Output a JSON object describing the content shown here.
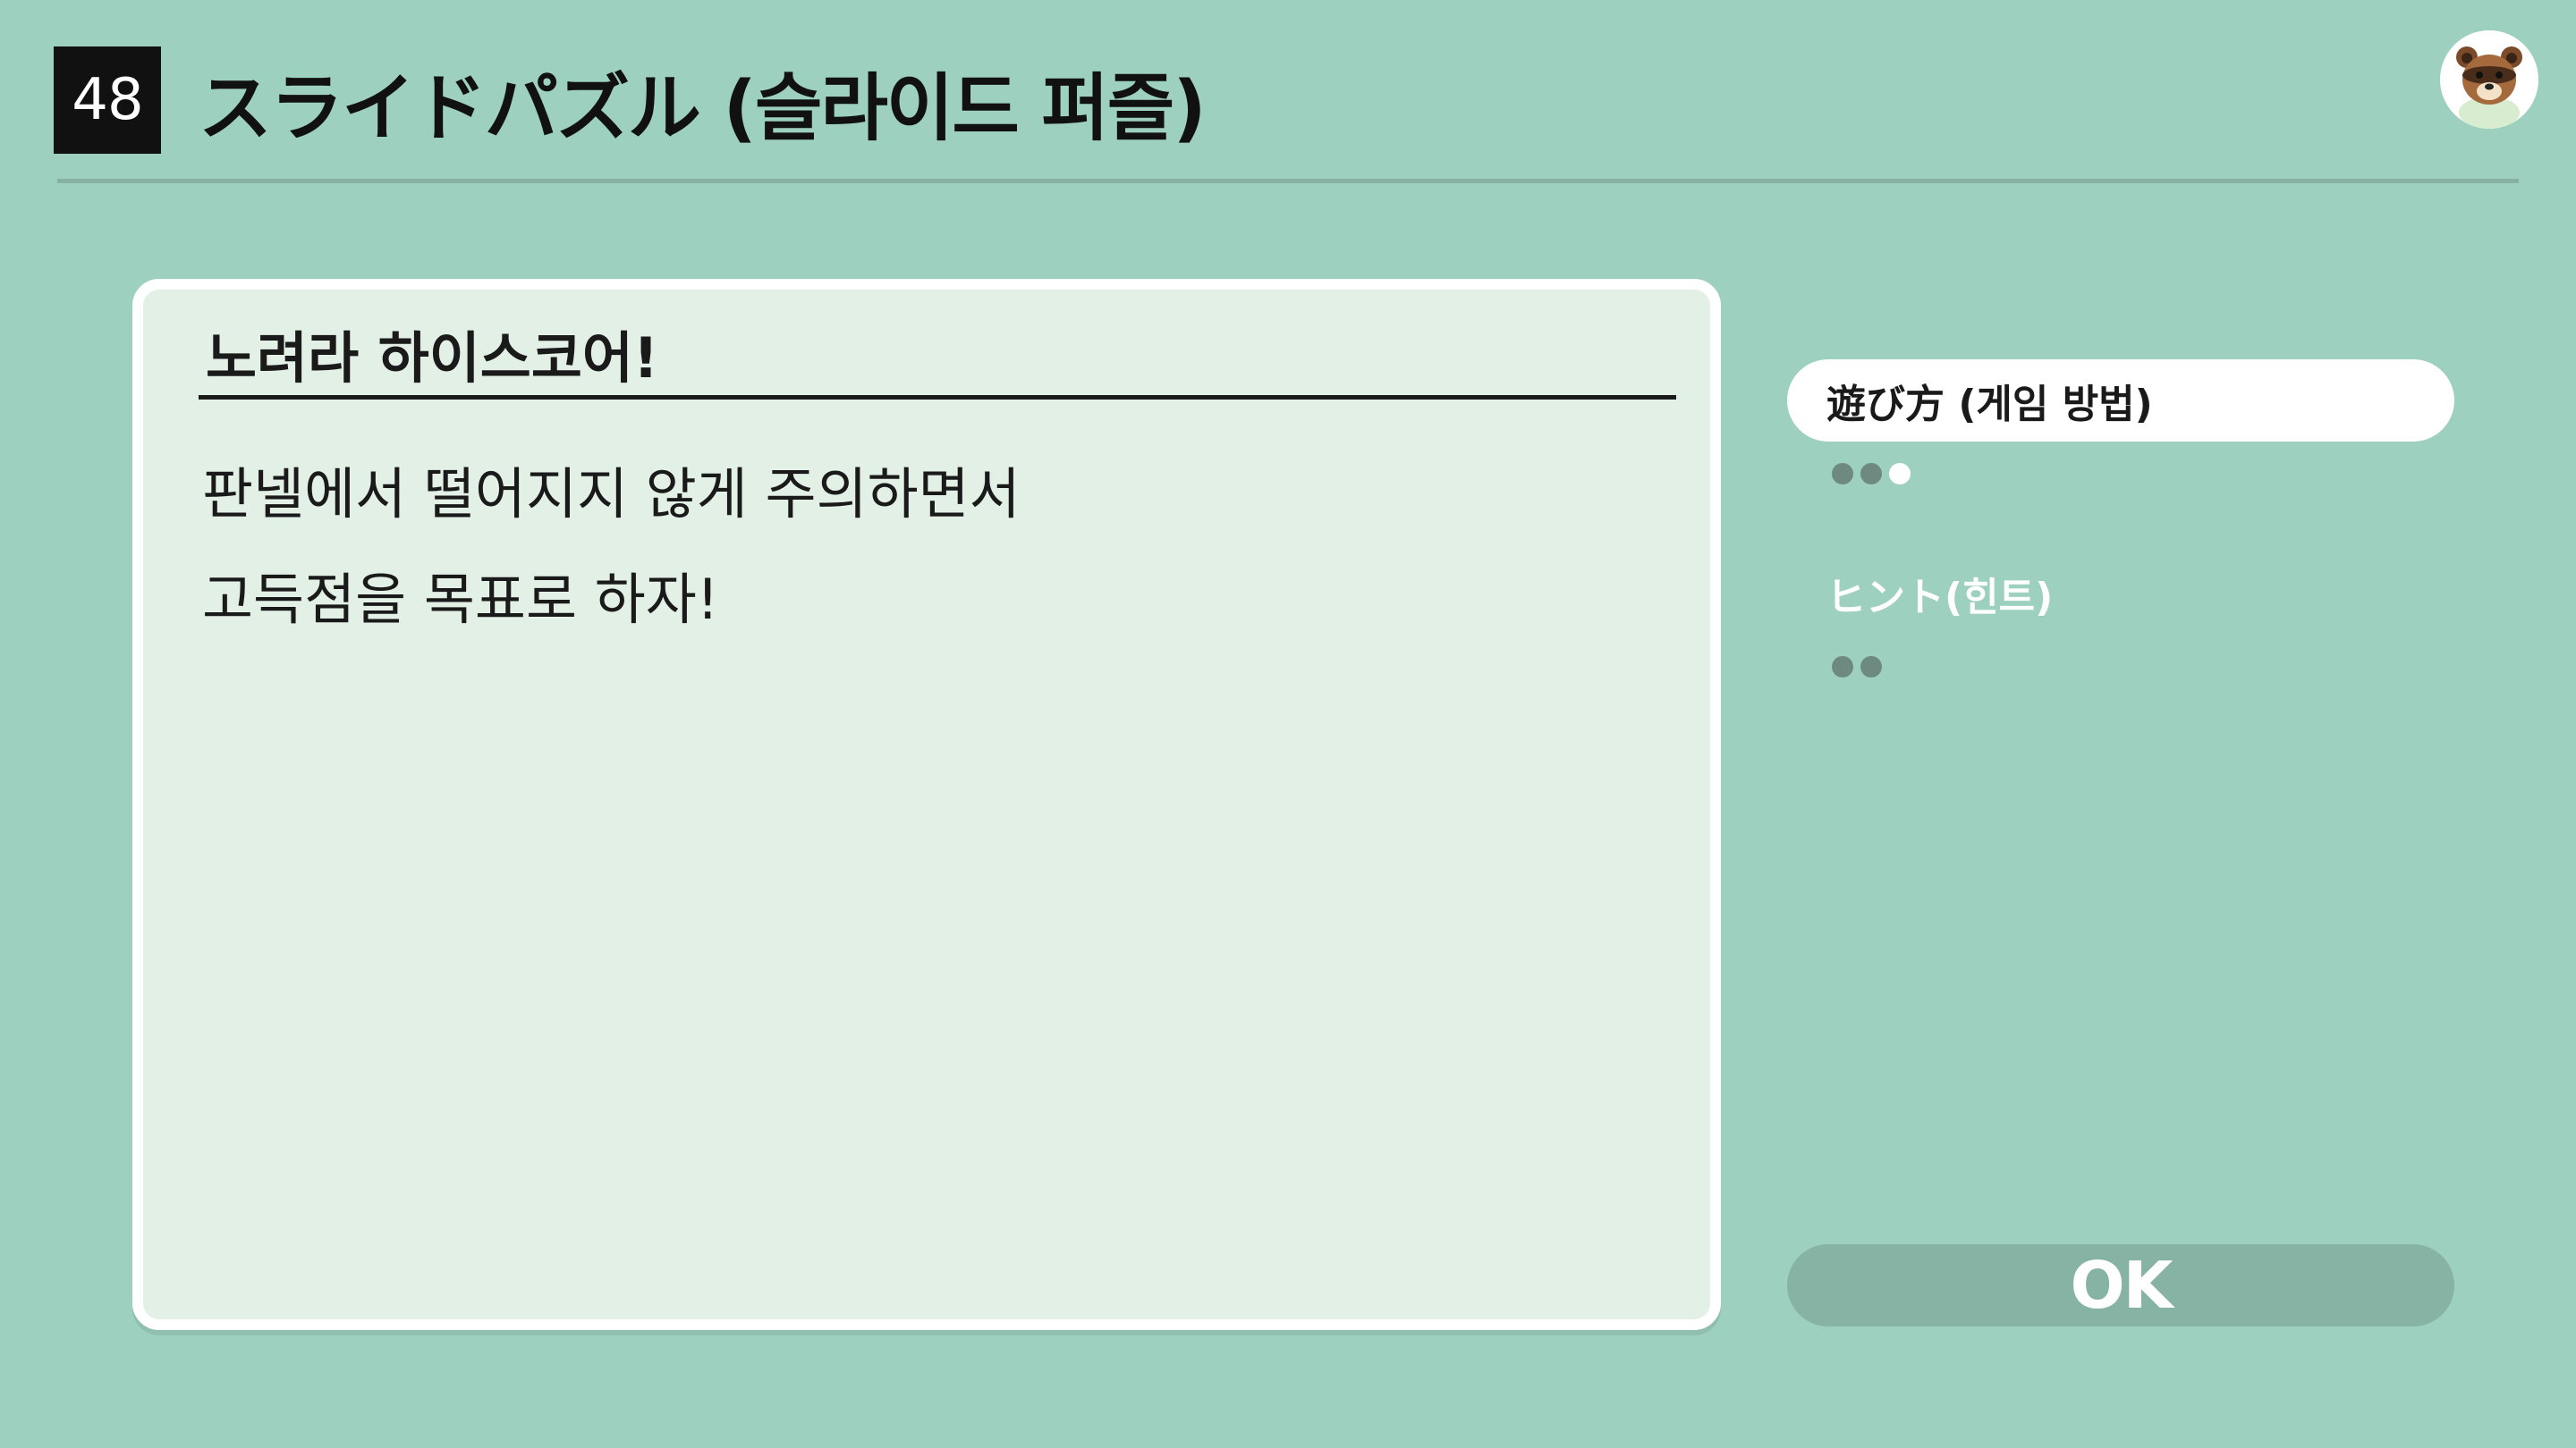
{
  "header": {
    "number": "48",
    "title": "スライドパズル (슬라이드 퍼즐)",
    "avatar_icon": "tom-nook-avatar-icon"
  },
  "panel": {
    "heading": "노려라 하이스코어!",
    "lines": [
      "판넬에서 떨어지지 않게 주의하면서",
      "고득점을 목표로 하자!"
    ]
  },
  "menu": {
    "items": [
      {
        "label": "遊び方 (게임 방법)",
        "state": "selected",
        "pages": 3,
        "current_page": 3
      },
      {
        "label": "ヒント(힌트)",
        "state": "unselected",
        "pages": 2,
        "current_page": 0
      }
    ]
  },
  "ok_button": {
    "label": "OK"
  },
  "colors": {
    "background": "#9dd0bf",
    "panel": "#e3f0e6",
    "panel_border": "#ffffff",
    "number_badge": "#111111",
    "ok_button": "#86b3a3",
    "dot_inactive": "#6e8a80",
    "dot_active": "#ffffff"
  }
}
